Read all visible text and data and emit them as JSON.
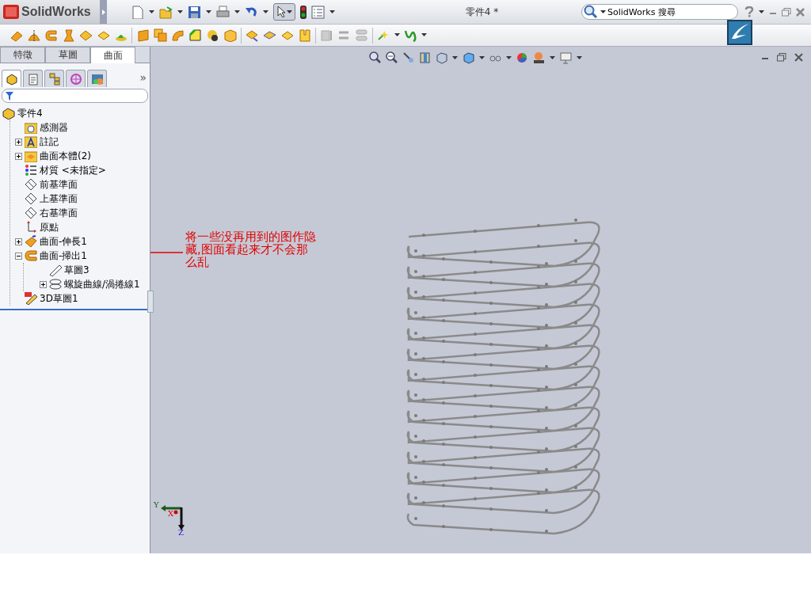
{
  "window": {
    "app_name": "SolidWorks",
    "title": "零件4 *"
  },
  "search": {
    "placeholder": "SolidWorks 搜尋"
  },
  "panel_tabs": [
    {
      "label": "特徵",
      "selected": false
    },
    {
      "label": "草圖",
      "selected": false
    },
    {
      "label": "曲面",
      "selected": true
    }
  ],
  "manager_tabs": [
    {
      "kind": "feature",
      "selected": true
    },
    {
      "kind": "property",
      "selected": false
    },
    {
      "kind": "config",
      "selected": false
    },
    {
      "kind": "dimxpert",
      "selected": false
    },
    {
      "kind": "display",
      "selected": false
    }
  ],
  "more_tabs": "»",
  "tree": {
    "label": "零件4",
    "kind": "part",
    "children": [
      {
        "label": "感測器",
        "kind": "sensor"
      },
      {
        "label": "註記",
        "kind": "annotation",
        "expanded": false
      },
      {
        "label": "曲面本體(2)",
        "kind": "bodies",
        "expanded": false
      },
      {
        "label": "材質 <未指定>",
        "kind": "material"
      },
      {
        "label": "前基準面",
        "kind": "plane"
      },
      {
        "label": "上基準面",
        "kind": "plane"
      },
      {
        "label": "右基準面",
        "kind": "plane"
      },
      {
        "label": "原點",
        "kind": "origin"
      },
      {
        "label": "曲面-伸長1",
        "kind": "extrude",
        "expanded": false
      },
      {
        "label": "曲面-掃出1",
        "kind": "sweep",
        "expanded": true,
        "children": [
          {
            "label": "草圖3",
            "kind": "sketch"
          },
          {
            "label": "螺旋曲線/渦捲線1",
            "kind": "helix",
            "expanded": false
          }
        ]
      },
      {
        "label": "3D草圖1",
        "kind": "sketch3d"
      }
    ]
  },
  "annotation": {
    "text": "将一些没再用到的图作隐藏,图面看起来才不会那么乱"
  },
  "triad": {
    "y": "Y",
    "x": "X",
    "z": "Z"
  }
}
